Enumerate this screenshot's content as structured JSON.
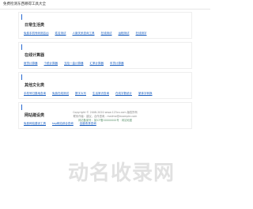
{
  "header": {
    "title": "免费检测东西哪得工具大全"
  },
  "sections": [
    {
      "title": "日常生活类",
      "links": [
        "免费手机号码测吉凶",
        "姓名测试",
        "人脉关系查询工具",
        "在线测试",
        "运程测试",
        "在线测字"
      ]
    },
    {
      "title": "在线计算器",
      "links": [
        "房贷计算器",
        "个税计算器",
        "五险一金计算器",
        "汇率计算器",
        "车贷计算器"
      ]
    },
    {
      "title": "其他文化类",
      "links": [
        "手机号归属地查询",
        "免费在线测试",
        "数字大写",
        "生活常识查询",
        "在线字数统计",
        "繁体字转换"
      ]
    },
    {
      "title": "网站建设类",
      "links": [
        "免费网站建设工具",
        "tag网站综合查询",
        "百度收录查询"
      ]
    }
  ],
  "footer": {
    "copyright": "Copyright © 2008-2020 www.123cx.com 版权所有",
    "contact": "联系作者：建议，合作咨询 - mailme@example.com",
    "beian": "网站备案号：某ICP备00000000号 · 网站地图"
  },
  "watermark": {
    "text": "动名收录网"
  },
  "colors": {
    "accent": "#2a6ad1",
    "link": "#1a5fc0",
    "border": "#eeeeee"
  }
}
